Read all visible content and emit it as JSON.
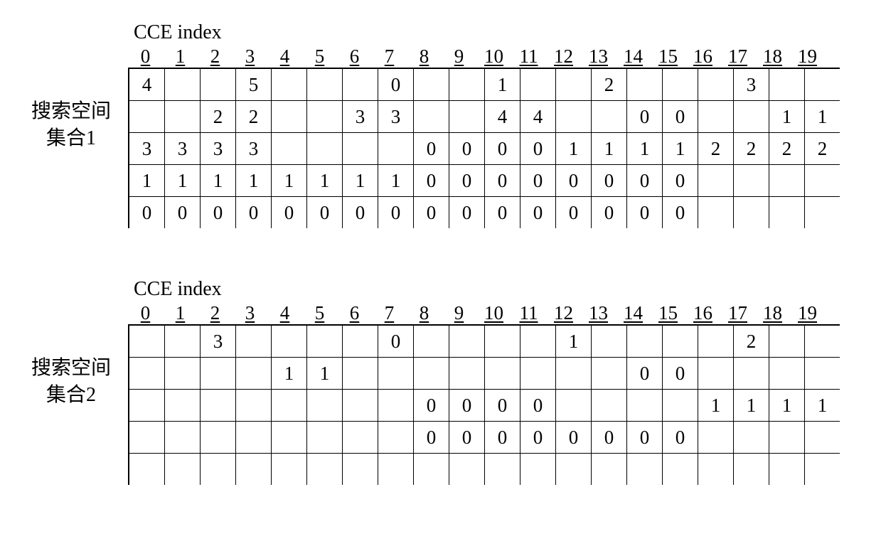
{
  "common": {
    "header_title": "CCE index",
    "indices": [
      "0",
      "1",
      "2",
      "3",
      "4",
      "5",
      "6",
      "7",
      "8",
      "9",
      "10",
      "11",
      "12",
      "13",
      "14",
      "15",
      "16",
      "17",
      "18",
      "19"
    ]
  },
  "set1": {
    "label_line1": "搜索空间",
    "label_line2": "集合1",
    "rows": [
      [
        "4",
        "",
        "",
        "5",
        "",
        "",
        "",
        "0",
        "",
        "",
        "1",
        "",
        "",
        "2",
        "",
        "",
        "",
        "3",
        "",
        ""
      ],
      [
        "",
        "",
        "2",
        "2",
        "",
        "",
        "3",
        "3",
        "",
        "",
        "4",
        "4",
        "",
        "",
        "0",
        "0",
        "",
        "",
        "1",
        "1"
      ],
      [
        "3",
        "3",
        "3",
        "3",
        "",
        "",
        "",
        "",
        "0",
        "0",
        "0",
        "0",
        "1",
        "1",
        "1",
        "1",
        "2",
        "2",
        "2",
        "2"
      ],
      [
        "1",
        "1",
        "1",
        "1",
        "1",
        "1",
        "1",
        "1",
        "0",
        "0",
        "0",
        "0",
        "0",
        "0",
        "0",
        "0",
        "",
        "",
        "",
        ""
      ],
      [
        "0",
        "0",
        "0",
        "0",
        "0",
        "0",
        "0",
        "0",
        "0",
        "0",
        "0",
        "0",
        "0",
        "0",
        "0",
        "0",
        "",
        "",
        "",
        ""
      ]
    ]
  },
  "set2": {
    "label_line1": "搜索空间",
    "label_line2": "集合2",
    "rows": [
      [
        "",
        "",
        "3",
        "",
        "",
        "",
        "",
        "0",
        "",
        "",
        "",
        "",
        "1",
        "",
        "",
        "",
        "",
        "2",
        "",
        ""
      ],
      [
        "",
        "",
        "",
        "",
        "1",
        "1",
        "",
        "",
        "",
        "",
        "",
        "",
        "",
        "",
        "0",
        "0",
        "",
        "",
        "",
        ""
      ],
      [
        "",
        "",
        "",
        "",
        "",
        "",
        "",
        "",
        "0",
        "0",
        "0",
        "0",
        "",
        "",
        "",
        "",
        "1",
        "1",
        "1",
        "1"
      ],
      [
        "",
        "",
        "",
        "",
        "",
        "",
        "",
        "",
        "0",
        "0",
        "0",
        "0",
        "0",
        "0",
        "0",
        "0",
        "",
        "",
        "",
        ""
      ],
      [
        "",
        "",
        "",
        "",
        "",
        "",
        "",
        "",
        "",
        "",
        "",
        "",
        "",
        "",
        "",
        "",
        "",
        "",
        "",
        ""
      ]
    ]
  },
  "chart_data": [
    {
      "type": "table",
      "title": "搜索空间 集合1 — CCE index",
      "columns": [
        0,
        1,
        2,
        3,
        4,
        5,
        6,
        7,
        8,
        9,
        10,
        11,
        12,
        13,
        14,
        15,
        16,
        17,
        18,
        19
      ],
      "rows": [
        [
          4,
          null,
          null,
          5,
          null,
          null,
          null,
          0,
          null,
          null,
          1,
          null,
          null,
          2,
          null,
          null,
          null,
          3,
          null,
          null
        ],
        [
          null,
          null,
          2,
          2,
          null,
          null,
          3,
          3,
          null,
          null,
          4,
          4,
          null,
          null,
          0,
          0,
          null,
          null,
          1,
          1
        ],
        [
          3,
          3,
          3,
          3,
          null,
          null,
          null,
          null,
          0,
          0,
          0,
          0,
          1,
          1,
          1,
          1,
          2,
          2,
          2,
          2
        ],
        [
          1,
          1,
          1,
          1,
          1,
          1,
          1,
          1,
          0,
          0,
          0,
          0,
          0,
          0,
          0,
          0,
          null,
          null,
          null,
          null
        ],
        [
          0,
          0,
          0,
          0,
          0,
          0,
          0,
          0,
          0,
          0,
          0,
          0,
          0,
          0,
          0,
          0,
          null,
          null,
          null,
          null
        ]
      ]
    },
    {
      "type": "table",
      "title": "搜索空间 集合2 — CCE index",
      "columns": [
        0,
        1,
        2,
        3,
        4,
        5,
        6,
        7,
        8,
        9,
        10,
        11,
        12,
        13,
        14,
        15,
        16,
        17,
        18,
        19
      ],
      "rows": [
        [
          null,
          null,
          3,
          null,
          null,
          null,
          null,
          0,
          null,
          null,
          null,
          null,
          1,
          null,
          null,
          null,
          null,
          2,
          null,
          null
        ],
        [
          null,
          null,
          null,
          null,
          1,
          1,
          null,
          null,
          null,
          null,
          null,
          null,
          null,
          null,
          0,
          0,
          null,
          null,
          null,
          null
        ],
        [
          null,
          null,
          null,
          null,
          null,
          null,
          null,
          null,
          0,
          0,
          0,
          0,
          null,
          null,
          null,
          null,
          1,
          1,
          1,
          1
        ],
        [
          null,
          null,
          null,
          null,
          null,
          null,
          null,
          null,
          0,
          0,
          0,
          0,
          0,
          0,
          0,
          0,
          null,
          null,
          null,
          null
        ],
        [
          null,
          null,
          null,
          null,
          null,
          null,
          null,
          null,
          null,
          null,
          null,
          null,
          null,
          null,
          null,
          null,
          null,
          null,
          null,
          null
        ]
      ]
    }
  ]
}
